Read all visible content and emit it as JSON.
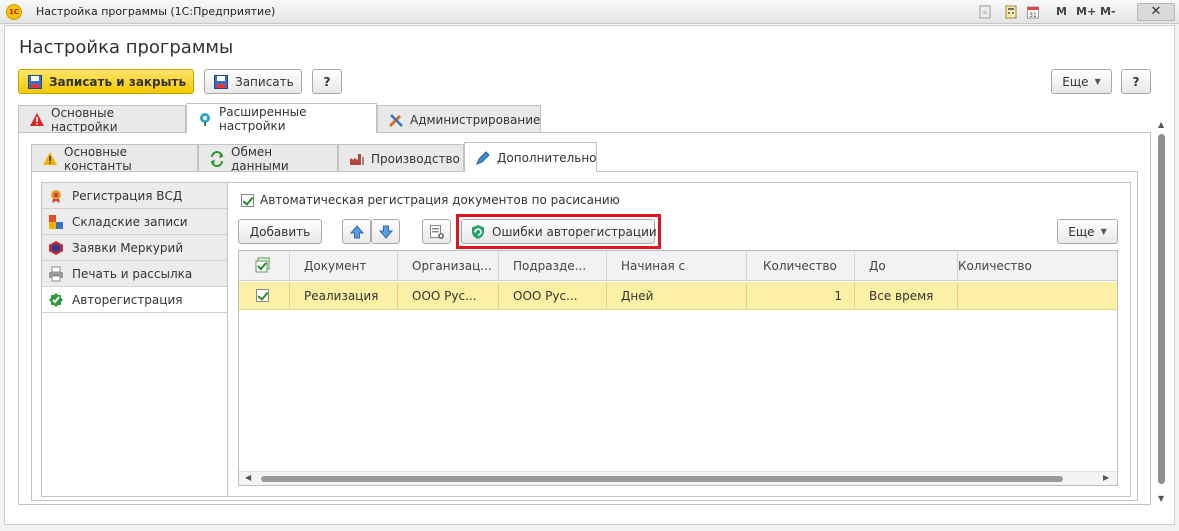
{
  "window": {
    "title": "Настройка программы  (1С:Предприятие)",
    "app_logo": "1С",
    "toolbar_right": [
      "M",
      "M+",
      "M-"
    ],
    "close_label": "✕"
  },
  "form": {
    "title": "Настройка программы",
    "buttons": {
      "save_close": "Записать и закрыть",
      "save": "Записать",
      "help": "?",
      "more": "Еще",
      "help_right": "?"
    }
  },
  "tabs_top": [
    {
      "label": "Основные настройки",
      "icon": "warning-icon"
    },
    {
      "label": "Расширенные настройки",
      "icon": "settings-flower-icon",
      "active": true
    },
    {
      "label": "Администрирование",
      "icon": "tools-icon"
    }
  ],
  "tabs_second": [
    {
      "label": "Основные константы",
      "icon": "warning-icon"
    },
    {
      "label": "Обмен данными",
      "icon": "exchange-icon"
    },
    {
      "label": "Производство",
      "icon": "factory-icon"
    },
    {
      "label": "Дополнительно",
      "icon": "pencil-icon",
      "active": true
    }
  ],
  "side_list": [
    {
      "label": "Регистрация ВСД",
      "icon": "certificate-icon"
    },
    {
      "label": "Складские записи",
      "icon": "blocks-icon"
    },
    {
      "label": "Заявки Меркурий",
      "icon": "mercury-icon"
    },
    {
      "label": "Печать и рассылка",
      "icon": "printer-icon"
    },
    {
      "label": "Авторегистрация",
      "icon": "check-badge-icon",
      "active": true
    }
  ],
  "main": {
    "auto_checkbox_label": "Автоматическая регистрация документов по расисанию",
    "auto_checked": true,
    "add_button": "Добавить",
    "errors_button": "Ошибки авторегистрации",
    "more_button": "Еще",
    "table": {
      "columns": [
        "Документ",
        "Организац...",
        "Подразде...",
        "Начиная с",
        "Количество",
        "До",
        "Количество"
      ],
      "rows": [
        {
          "checked": true,
          "cells": [
            "Реализация",
            "ООО Рус...",
            "ООО Рус...",
            "Дней",
            "1",
            "Все время",
            ""
          ]
        }
      ]
    }
  },
  "colors": {
    "primary_button": "#f3c800",
    "selected_row": "#fbf0a4",
    "highlight": "#e0141e"
  }
}
